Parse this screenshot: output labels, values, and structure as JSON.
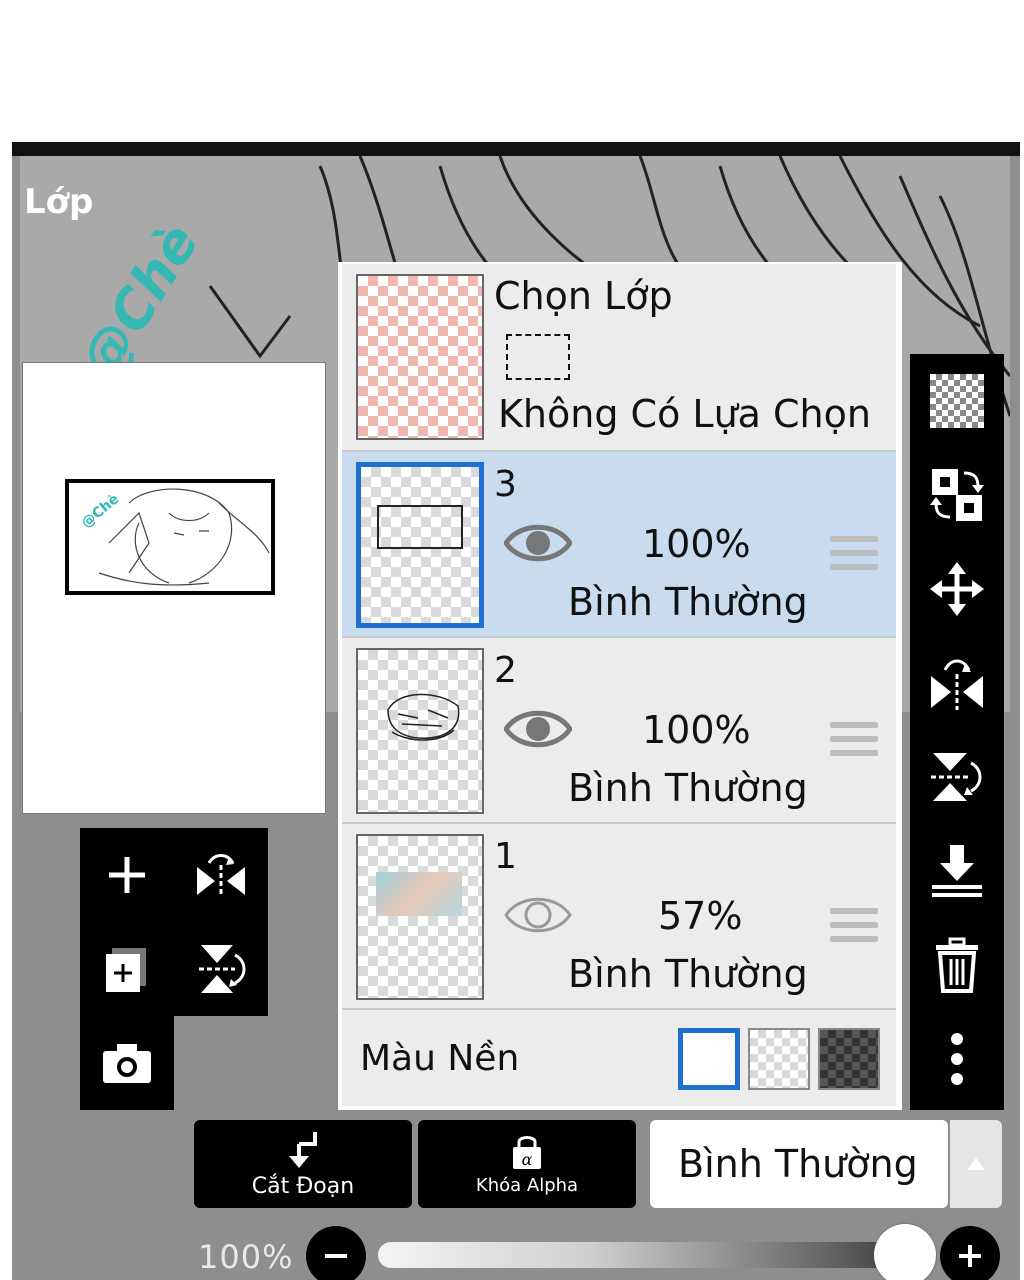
{
  "panel": {
    "title": "Lớp",
    "watermark": "@Chè"
  },
  "selection_row": {
    "title": "Chọn Lớp",
    "status": "Không Có Lựa Chọn"
  },
  "layers": [
    {
      "number": "3",
      "opacity": "100%",
      "blend": "Bình Thường",
      "visible": true,
      "selected": true
    },
    {
      "number": "2",
      "opacity": "100%",
      "blend": "Bình Thường",
      "visible": true,
      "selected": false
    },
    {
      "number": "1",
      "opacity": "57%",
      "blend": "Bình Thường",
      "visible": false,
      "selected": false
    }
  ],
  "background": {
    "label": "Màu Nền",
    "options": [
      "white",
      "transparent",
      "dark"
    ],
    "selected": "white"
  },
  "left_tools": [
    "add-layer-icon",
    "flip-horizontal-icon",
    "copy-layer-icon",
    "flip-vertical-icon",
    "camera-icon"
  ],
  "right_tools": [
    "transparency-icon",
    "swap-layers-icon",
    "move-icon",
    "flip-horizontal-icon",
    "flip-vertical-icon",
    "merge-down-icon",
    "trash-icon",
    "more-icon"
  ],
  "bottom": {
    "clip_label": "Cắt Đoạn",
    "alpha_label": "Khóa Alpha",
    "blend_mode": "Bình Thường"
  },
  "opacity_slider": {
    "label": "100%",
    "value": 100
  },
  "colors": {
    "accent": "#1e6fd0",
    "selected_row": "#c9dcef",
    "toolbar": "#000000",
    "panel": "#8e8e8e"
  }
}
